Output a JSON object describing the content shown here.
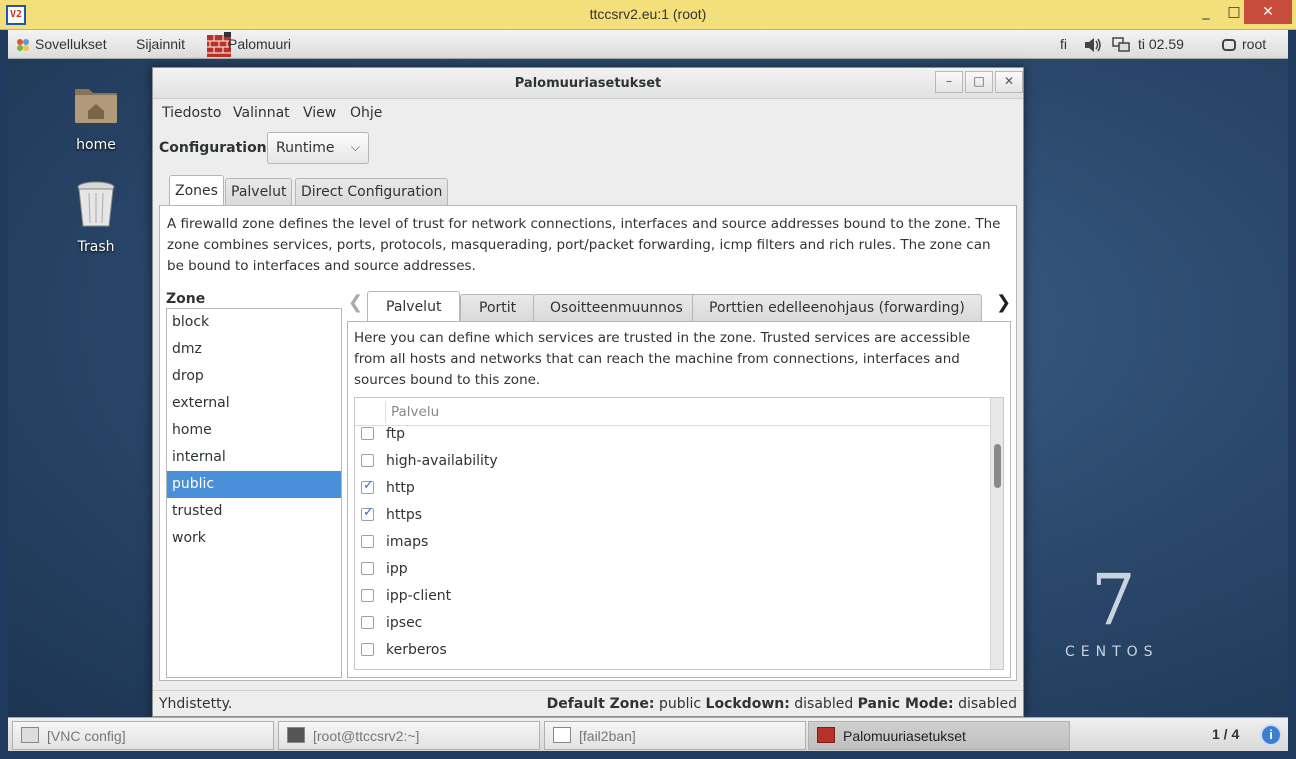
{
  "vnc": {
    "title": "ttccsrv2.eu:1 (root)",
    "logo": "V2",
    "min": "_",
    "max": "□",
    "close": "✕"
  },
  "topbar": {
    "applications": "Sovellukset",
    "places": "Sijainnit",
    "app_name": "Palomuuri",
    "keyboard": "fi",
    "time": "ti 02.59",
    "user": "root"
  },
  "desktop": {
    "icons": [
      {
        "label": "home"
      },
      {
        "label": "Trash"
      }
    ],
    "brand_number": "7",
    "brand_word": "CENTOS"
  },
  "window": {
    "title": "Palomuuriasetukset",
    "menu": [
      "Tiedosto",
      "Valinnat",
      "View",
      "Ohje"
    ],
    "configuration_label": "Configuration:",
    "configuration_value": "Runtime",
    "tabs": [
      "Zones",
      "Palvelut",
      "Direct Configuration"
    ],
    "zone_description": "A firewalld zone defines the level of trust for network connections, interfaces and source addresses bound to the zone. The zone combines services, ports, protocols, masquerading, port/packet forwarding, icmp filters and rich rules. The zone can be bound to interfaces and source addresses.",
    "zone_header": "Zone",
    "zones": [
      "block",
      "dmz",
      "drop",
      "external",
      "home",
      "internal",
      "public",
      "trusted",
      "work"
    ],
    "selected_zone": "public",
    "subtabs": [
      "Palvelut",
      "Portit",
      "Osoitteenmuunnos",
      "Porttien edelleenohjaus (forwarding)"
    ],
    "services_description": "Here you can define which services are trusted in the zone. Trusted services are accessible from all hosts and networks that can reach the machine from connections, interfaces and sources bound to this zone.",
    "services_column": "Palvelu",
    "services": [
      {
        "name": "ftp",
        "checked": false
      },
      {
        "name": "high-availability",
        "checked": false
      },
      {
        "name": "http",
        "checked": true
      },
      {
        "name": "https",
        "checked": true
      },
      {
        "name": "imaps",
        "checked": false
      },
      {
        "name": "ipp",
        "checked": false
      },
      {
        "name": "ipp-client",
        "checked": false
      },
      {
        "name": "ipsec",
        "checked": false
      },
      {
        "name": "kerberos",
        "checked": false
      }
    ],
    "status": {
      "connection": "Yhdistetty.",
      "default_zone_label": "Default Zone:",
      "default_zone": "public",
      "lockdown_label": "Lockdown:",
      "lockdown": "disabled",
      "panic_label": "Panic Mode:",
      "panic": "disabled"
    }
  },
  "taskbar": {
    "tasks": [
      "[VNC config]",
      "[root@ttccsrv2:~]",
      "[fail2ban]",
      "Palomuuriasetukset"
    ],
    "workspace": "1 / 4",
    "info": "i"
  },
  "colors": {
    "selection": "#4a90d9",
    "vnc_titlebar": "#f3e07a",
    "close_button": "#c74c3c"
  }
}
